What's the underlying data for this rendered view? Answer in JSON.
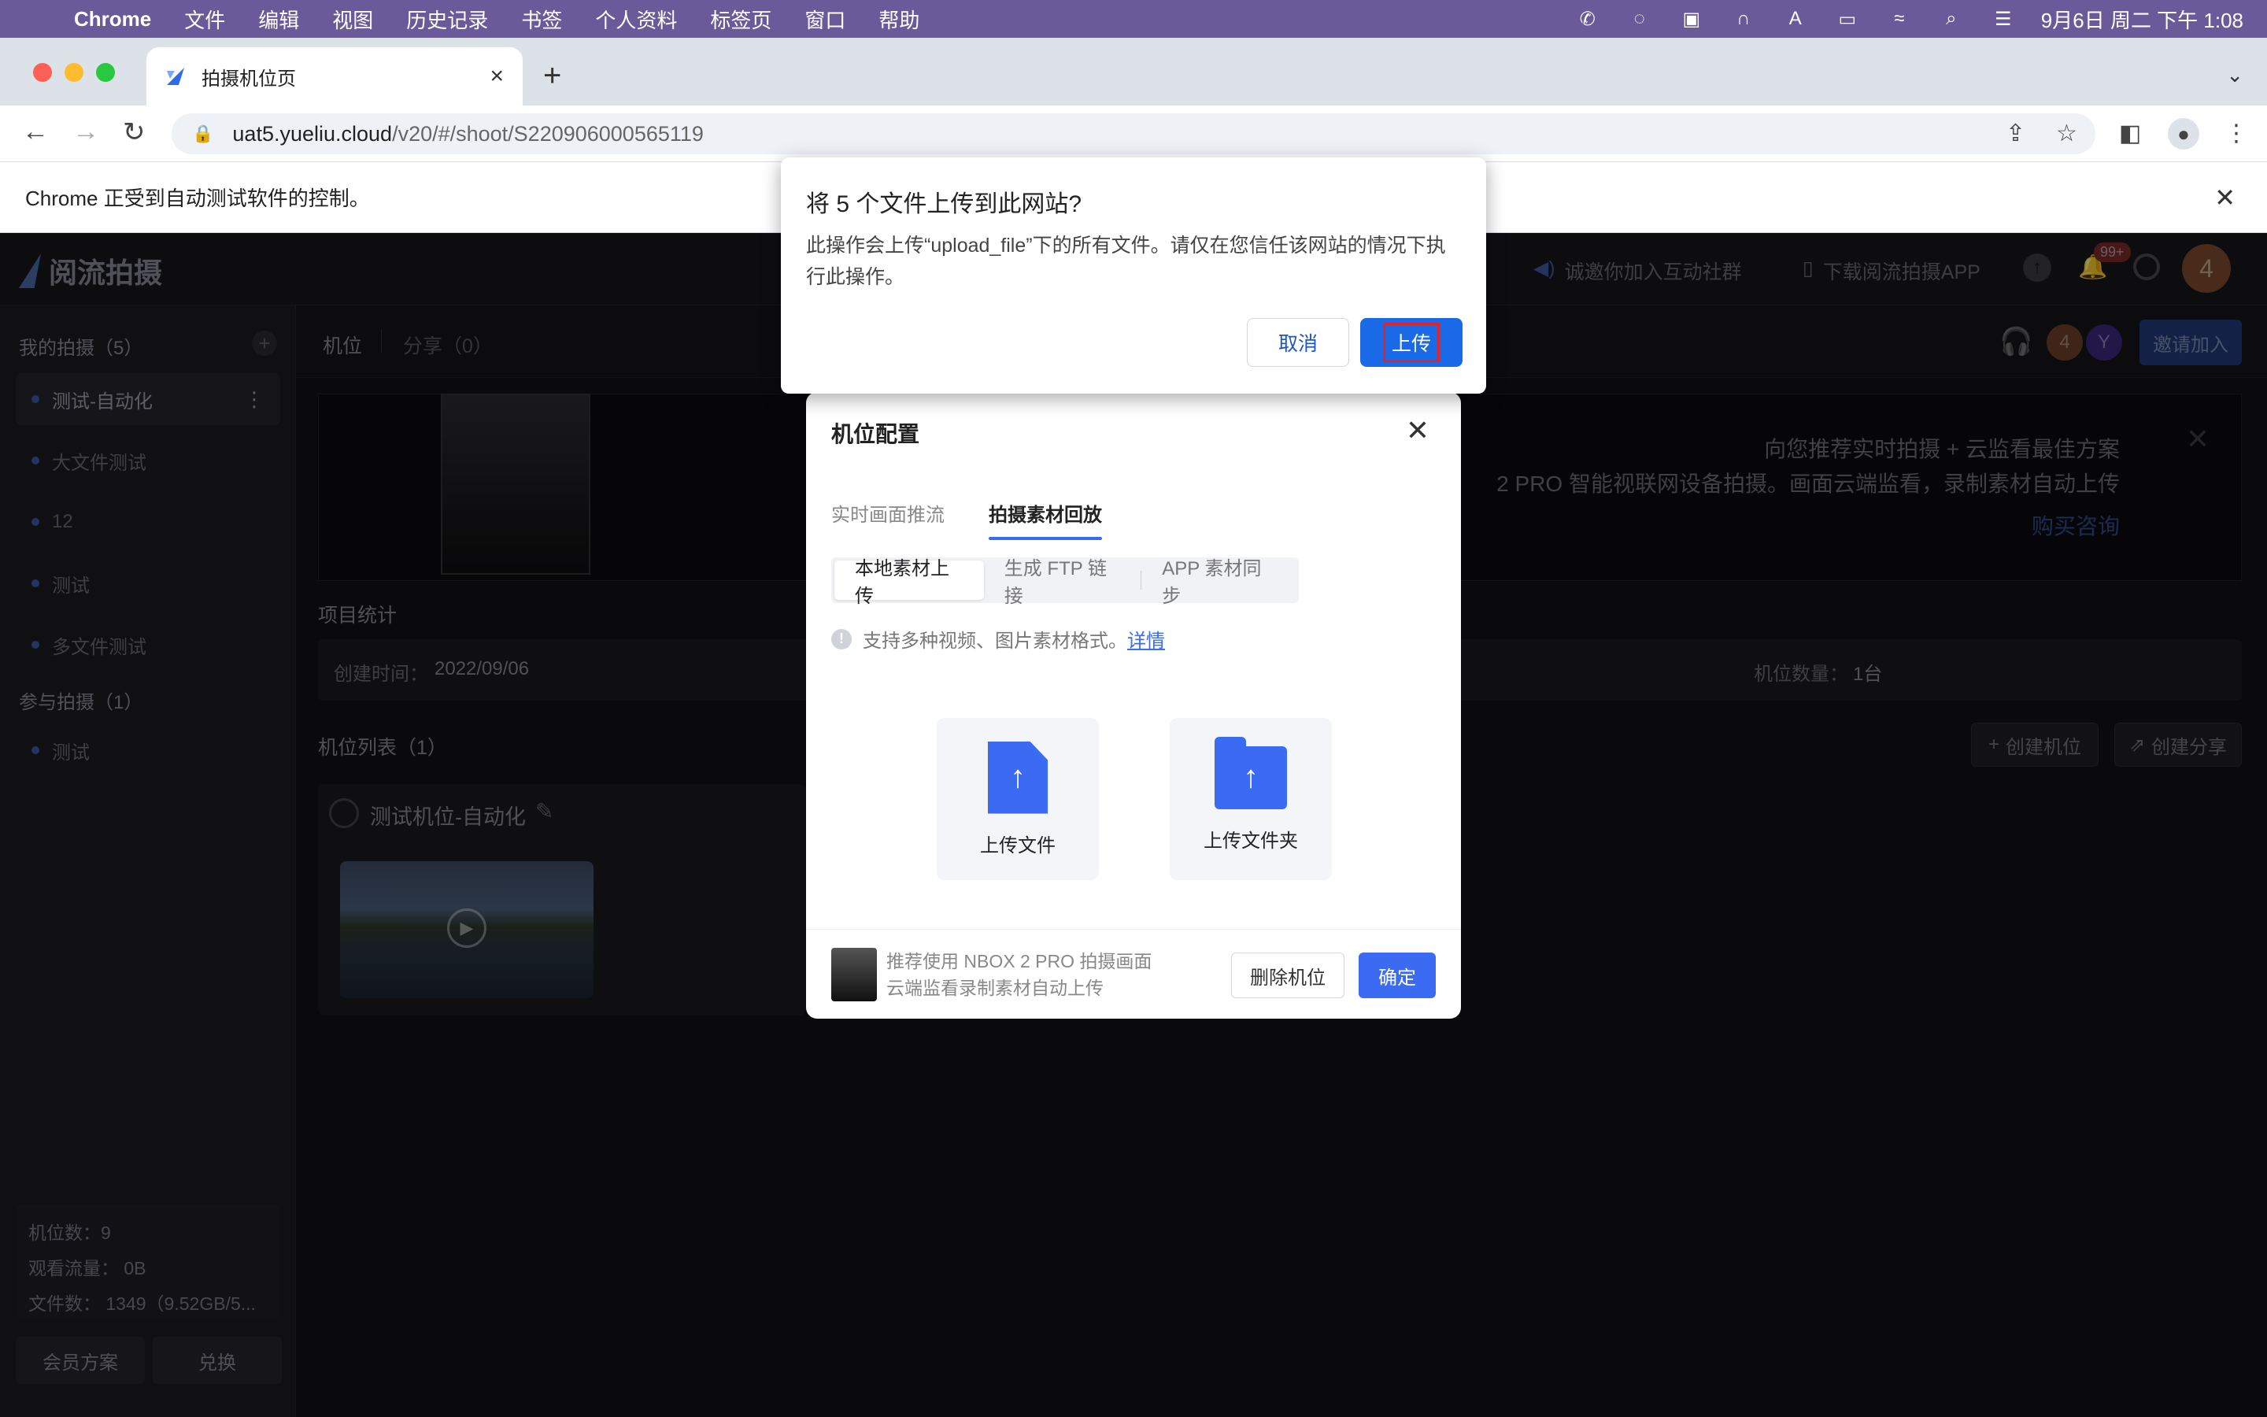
{
  "menubar": {
    "app": "Chrome",
    "items": [
      "文件",
      "编辑",
      "视图",
      "历史记录",
      "书签",
      "个人资料",
      "标签页",
      "窗口",
      "帮助"
    ],
    "clock": "9月6日 周二 下午 1:08"
  },
  "browser": {
    "tab_title": "拍摄机位页",
    "url_host": "uat5.yueliu.cloud",
    "url_path": "/v20/#/shoot/S220906000565119",
    "infobar": "Chrome 正受到自动测试软件的控制。"
  },
  "app": {
    "logo": "阅流拍摄",
    "header": {
      "community": "诚邀你加入互动社群",
      "download": "下载阅流拍摄APP",
      "notif_badge": "99+",
      "avatar": "4"
    },
    "sidebar": {
      "my_shoots": "我的拍摄（5）",
      "items": [
        "测试-自动化",
        "大文件测试",
        "12",
        "测试",
        "多文件测试"
      ],
      "joined": "参与拍摄（1）",
      "joined_items": [
        "测试"
      ],
      "stats": [
        "机位数：9",
        "观看流量：  0B",
        "文件数：  1349（9.52GB/5..."
      ],
      "member_btn": "会员方案",
      "redeem_btn": "兑换"
    },
    "subhdr": {
      "tab_position": "机位",
      "tab_share": "分享（0）",
      "avatars": [
        "4",
        "Y"
      ],
      "invite": "邀请加入"
    },
    "banner": {
      "line1": "向您推荐实时拍摄 + 云监看最佳方案",
      "line2": "2 PRO 智能视联网设备拍摄。画面云端监看，录制素材自动上传",
      "buy": "购买咨询"
    },
    "project_stats_title": "项目统计",
    "created_label": "创建时间：",
    "created_value": "2022/09/06",
    "count_label": "机位数量：",
    "count_value": "1台",
    "list_title": "机位列表（1）",
    "create_pos": "创建机位",
    "create_share": "创建分享",
    "camera_name": "测试机位-自动化"
  },
  "modal": {
    "title": "机位配置",
    "tabs": [
      "实时画面推流",
      "拍摄素材回放"
    ],
    "segments": [
      "本地素材上传",
      "生成 FTP 链接",
      "APP 素材同步"
    ],
    "tip": "支持多种视频、图片素材格式。",
    "tip_link": "详情",
    "upload_file": "上传文件",
    "upload_folder": "上传文件夹",
    "footer_line1": "推荐使用 NBOX 2 PRO 拍摄画面",
    "footer_line2": "云端监看录制素材自动上传",
    "delete_btn": "删除机位",
    "ok_btn": "确定"
  },
  "dialog": {
    "title": "将 5 个文件上传到此网站?",
    "body": "此操作会上传“upload_file”下的所有文件。请仅在您信任该网站的情况下执行此操作。",
    "cancel": "取消",
    "upload": "上传"
  },
  "colors": {
    "accent": "#3b6bf2",
    "chrome_blue": "#1a6ae8",
    "menubar": "#6b5a9a"
  }
}
